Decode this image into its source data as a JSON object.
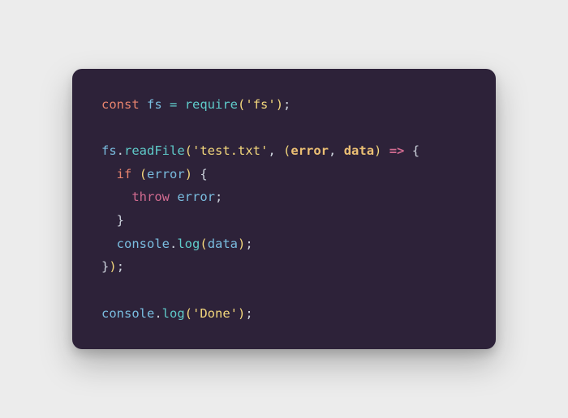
{
  "code": {
    "tokens": {
      "l1_const": "const",
      "l1_fs": "fs",
      "l1_eq": " = ",
      "l1_require": "require",
      "l1_lpar": "(",
      "l1_str": "'fs'",
      "l1_rpar": ")",
      "l1_semi": ";",
      "l3_fs": "fs",
      "l3_dot": ".",
      "l3_readFile": "readFile",
      "l3_lpar": "(",
      "l3_str": "'test.txt'",
      "l3_comma": ", ",
      "l3_lpar2": "(",
      "l3_error": "error",
      "l3_comma2": ", ",
      "l3_data": "data",
      "l3_rpar2": ")",
      "l3_arrow": " => ",
      "l3_lbrace": "{",
      "l4_indent": "  ",
      "l4_if": "if",
      "l4_sp": " ",
      "l4_lpar": "(",
      "l4_error": "error",
      "l4_rpar": ")",
      "l4_sp2": " ",
      "l4_lbrace": "{",
      "l5_indent": "    ",
      "l5_throw": "throw",
      "l5_sp": " ",
      "l5_error": "error",
      "l5_semi": ";",
      "l6_indent": "  ",
      "l6_rbrace": "}",
      "l7_indent": "  ",
      "l7_console": "console",
      "l7_dot": ".",
      "l7_log": "log",
      "l7_lpar": "(",
      "l7_data": "data",
      "l7_rpar": ")",
      "l7_semi": ";",
      "l8_rbrace": "}",
      "l8_rpar": ")",
      "l8_semi": ";",
      "l10_console": "console",
      "l10_dot": ".",
      "l10_log": "log",
      "l10_lpar": "(",
      "l10_str": "'Done'",
      "l10_rpar": ")",
      "l10_semi": ";"
    }
  }
}
